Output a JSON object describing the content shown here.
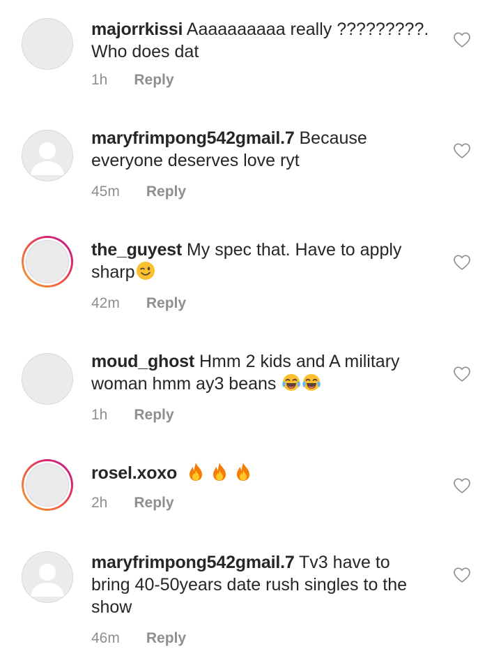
{
  "comments": [
    {
      "username": "majorrkissi",
      "text": " Aaaaaaaaaa really ?????????. Who does dat",
      "time": "1h",
      "reply_label": "Reply",
      "avatar": "plain-circle",
      "emoji": []
    },
    {
      "username": "maryfrimpong542gmail.7",
      "text": " Because everyone deserves love ryt",
      "time": "45m",
      "reply_label": "Reply",
      "avatar": "default-user-silhouette",
      "emoji": []
    },
    {
      "username": "the_guyest",
      "text": " My spec that. Have to apply sharp",
      "time": "42m",
      "reply_label": "Reply",
      "avatar": "story-ring",
      "emoji": [
        "winking-face"
      ]
    },
    {
      "username": "moud_ghost",
      "text": " Hmm 2 kids and A military woman hmm ay3 beans ",
      "time": "1h",
      "reply_label": "Reply",
      "avatar": "plain-circle",
      "emoji": [
        "tears-of-joy",
        "tears-of-joy"
      ]
    },
    {
      "username": "rosel.xoxo",
      "text": " ",
      "time": "2h",
      "reply_label": "Reply",
      "avatar": "story-ring",
      "emoji": [
        "fire",
        "fire",
        "fire"
      ]
    },
    {
      "username": "maryfrimpong542gmail.7",
      "text": " Tv3 have to bring 40-50years date rush singles to the show",
      "time": "46m",
      "reply_label": "Reply",
      "avatar": "default-user-silhouette",
      "emoji": []
    }
  ],
  "icons": {
    "like": "heart-outline-icon"
  },
  "colors": {
    "text": "#262626",
    "meta": "#8e8e8e",
    "heart_stroke": "#8e8e8e"
  }
}
